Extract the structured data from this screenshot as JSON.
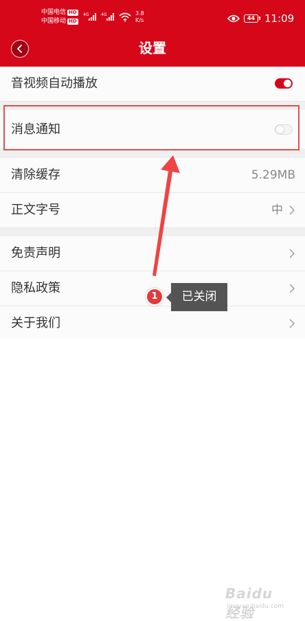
{
  "status_bar": {
    "carrier1": "中国电信",
    "carrier2": "中国移动",
    "hd_badge": "HD",
    "network_tag": "4G",
    "net_speed_value": "3.8",
    "net_speed_unit": "K/s",
    "battery": "44",
    "time": "11:09"
  },
  "nav": {
    "title": "设置",
    "back_icon": "chevron-left-icon"
  },
  "settings": {
    "autoplay_label": "音视频自动播放",
    "autoplay_on": true,
    "notification_label": "消息通知",
    "notification_on": false,
    "clear_cache_label": "清除缓存",
    "cache_size": "5.29MB",
    "font_size_label": "正文字号",
    "font_size_value": "中",
    "disclaimer_label": "免责声明",
    "privacy_label": "隐私政策",
    "about_label": "关于我们"
  },
  "annotation": {
    "step_number": "1",
    "tooltip_text": "已关闭"
  },
  "watermark": {
    "mark": "Baidu 经验",
    "url": "jingyan.baidu.com"
  },
  "colors": {
    "brand_red": "#d7071a",
    "annotation_red": "#e84b4b",
    "tooltip_bg": "#545454"
  }
}
